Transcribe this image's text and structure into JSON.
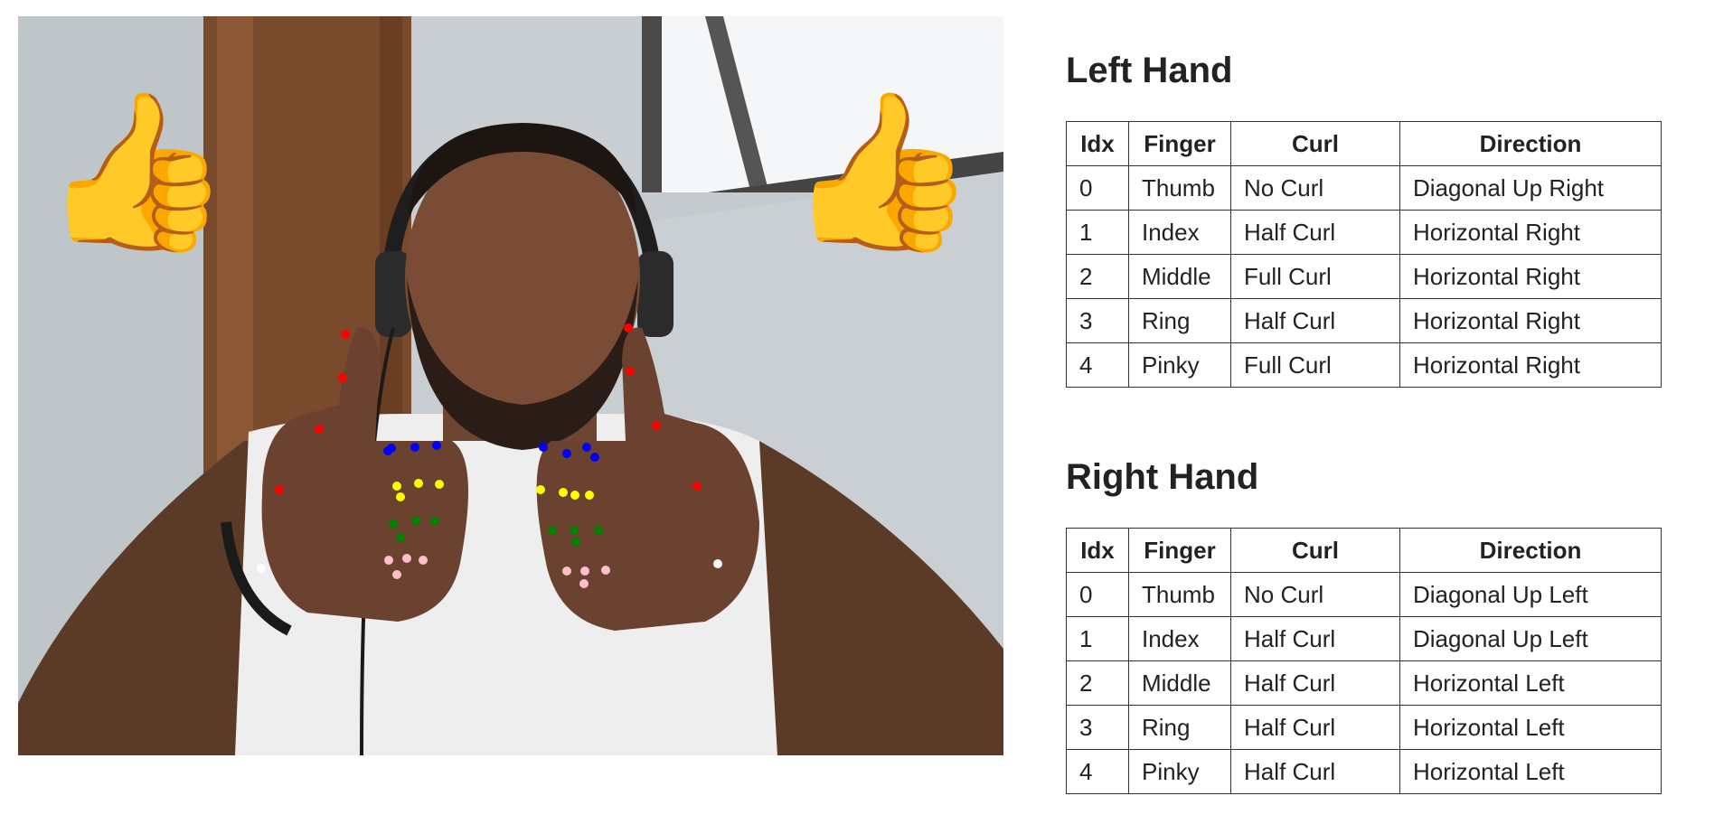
{
  "video": {
    "left_emoji": "👍",
    "right_emoji": "👍",
    "landmark_colors": {
      "thumb": "#ff0000",
      "index": "#0000ff",
      "middle": "#ffff00",
      "ring": "#008000",
      "pinky": "#ffc0cb",
      "wrist": "#ffffff"
    }
  },
  "left_hand": {
    "title": "Left Hand",
    "headers": {
      "idx": "Idx",
      "finger": "Finger",
      "curl": "Curl",
      "direction": "Direction"
    },
    "rows": [
      {
        "idx": "0",
        "finger": "Thumb",
        "curl": "No Curl",
        "direction": "Diagonal Up Right"
      },
      {
        "idx": "1",
        "finger": "Index",
        "curl": "Half Curl",
        "direction": "Horizontal Right"
      },
      {
        "idx": "2",
        "finger": "Middle",
        "curl": "Full Curl",
        "direction": "Horizontal Right"
      },
      {
        "idx": "3",
        "finger": "Ring",
        "curl": "Half Curl",
        "direction": "Horizontal Right"
      },
      {
        "idx": "4",
        "finger": "Pinky",
        "curl": "Full Curl",
        "direction": "Horizontal Right"
      }
    ]
  },
  "right_hand": {
    "title": "Right Hand",
    "headers": {
      "idx": "Idx",
      "finger": "Finger",
      "curl": "Curl",
      "direction": "Direction"
    },
    "rows": [
      {
        "idx": "0",
        "finger": "Thumb",
        "curl": "No Curl",
        "direction": "Diagonal Up Left"
      },
      {
        "idx": "1",
        "finger": "Index",
        "curl": "Half Curl",
        "direction": "Diagonal Up Left"
      },
      {
        "idx": "2",
        "finger": "Middle",
        "curl": "Half Curl",
        "direction": "Horizontal Left"
      },
      {
        "idx": "3",
        "finger": "Ring",
        "curl": "Half Curl",
        "direction": "Horizontal Left"
      },
      {
        "idx": "4",
        "finger": "Pinky",
        "curl": "Half Curl",
        "direction": "Horizontal Left"
      }
    ]
  }
}
